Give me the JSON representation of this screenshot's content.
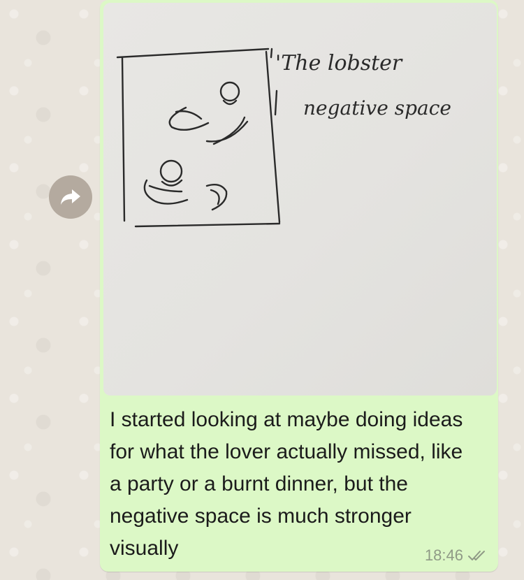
{
  "message": {
    "photo_annotation_line1": "'The lobster",
    "photo_annotation_line2": "negative space",
    "caption": "I started looking at maybe doing ideas for what the lover actually missed, like a party or a burnt dinner, but the negative space is much stronger visually",
    "timestamp": "18:46",
    "status": "delivered-double-check"
  },
  "icons": {
    "forward": "forward-arrow-icon",
    "status": "double-check-icon"
  },
  "colors": {
    "bubble": "#dcf8c6",
    "wallpaper": "#e9e4dc",
    "forward_button": "#b4aa9f"
  }
}
